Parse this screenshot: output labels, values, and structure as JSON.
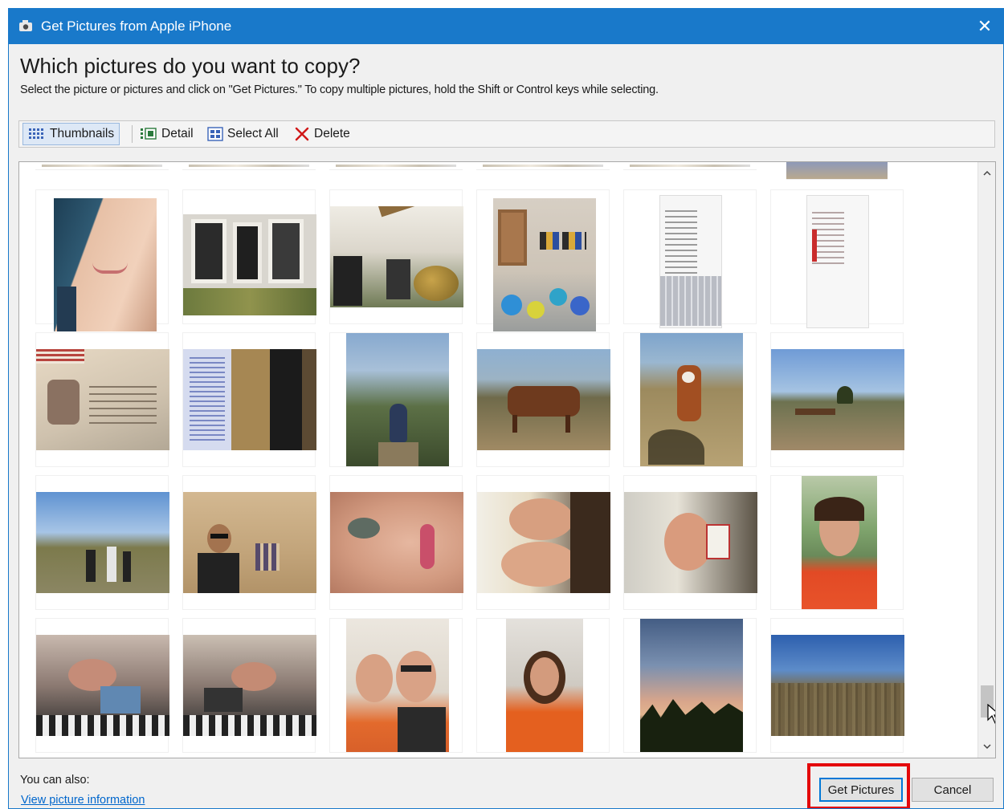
{
  "window": {
    "title": "Get Pictures from Apple iPhone",
    "close_glyph": "✕",
    "accent_color": "#1979ca"
  },
  "heading": "Which pictures do you want to copy?",
  "instructions": "Select the picture or pictures and click on \"Get Pictures.\" To copy multiple pictures, hold the Shift or Control keys while selecting.",
  "toolbar": {
    "thumbnails_label": "Thumbnails",
    "detail_label": "Detail",
    "select_all_label": "Select All",
    "delete_label": "Delete",
    "active_view": "Thumbnails"
  },
  "gallery": {
    "row_count_visible": 4,
    "columns": 6,
    "photos": [
      "selfie-closeup-icon",
      "house-doors-icon",
      "patio-pumpkin-icon",
      "room-shelves-icon",
      "phone-screenshot-icon",
      "phone-screenshot-icon",
      "passport-icon",
      "document-icon",
      "hiker-trail-icon",
      "cow-field-icon",
      "calf-icon",
      "landscape-icon",
      "group-hike-icon",
      "canyon-selfie-icon",
      "face-closeup-icon",
      "two-girls-selfie-icon",
      "girl-card-selfie-icon",
      "girl-portrait-icon",
      "party-upside-icon",
      "party-upside-icon",
      "father-daughter-icon",
      "girl-orange-shirt-icon",
      "sunset-trees-icon",
      "valley-landscape-icon"
    ]
  },
  "footer": {
    "also_label": "You can also:",
    "link_label": "View picture information",
    "get_pictures_label": "Get Pictures",
    "cancel_label": "Cancel",
    "highlight_color": "#e4080a"
  }
}
